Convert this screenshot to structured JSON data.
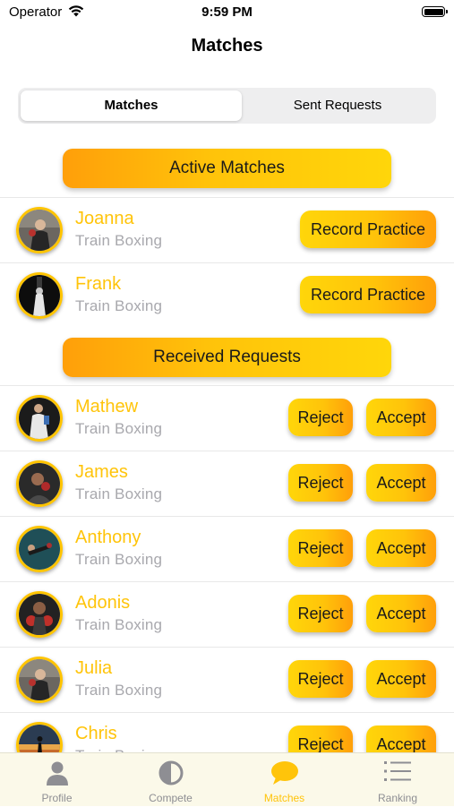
{
  "status_bar": {
    "carrier": "Operator",
    "time": "9:59 PM"
  },
  "header": {
    "title": "Matches"
  },
  "segmented": {
    "active": "Matches",
    "inactive": "Sent Requests"
  },
  "sections": {
    "active_title": "Active Matches",
    "received_title": "Received Requests"
  },
  "active_matches": [
    {
      "name": "Joanna",
      "subtitle": "Train  Boxing",
      "button": "Record Practice"
    },
    {
      "name": "Frank",
      "subtitle": "Train  Boxing",
      "button": "Record Practice"
    }
  ],
  "received_requests": [
    {
      "name": "Mathew",
      "subtitle": "Train  Boxing",
      "reject": "Reject",
      "accept": "Accept"
    },
    {
      "name": "James",
      "subtitle": "Train  Boxing",
      "reject": "Reject",
      "accept": "Accept"
    },
    {
      "name": "Anthony",
      "subtitle": "Train  Boxing",
      "reject": "Reject",
      "accept": "Accept"
    },
    {
      "name": "Adonis",
      "subtitle": "Train  Boxing",
      "reject": "Reject",
      "accept": "Accept"
    },
    {
      "name": "Julia",
      "subtitle": "Train  Boxing",
      "reject": "Reject",
      "accept": "Accept"
    },
    {
      "name": "Chris",
      "subtitle": "Train  Boxing",
      "reject": "Reject",
      "accept": "Accept"
    }
  ],
  "tabs": [
    {
      "label": "Profile",
      "icon": "person-icon",
      "active": false
    },
    {
      "label": "Compete",
      "icon": "contrast-icon",
      "active": false
    },
    {
      "label": "Matches",
      "icon": "chat-bubble-icon",
      "active": true
    },
    {
      "label": "Ranking",
      "icon": "list-icon",
      "active": false
    }
  ],
  "colors": {
    "accent": "#ffc40a",
    "accent_orange": "#ff9f0a",
    "subtitle_gray": "#a8a8ad",
    "tab_bar_bg": "#fbf9e9"
  }
}
